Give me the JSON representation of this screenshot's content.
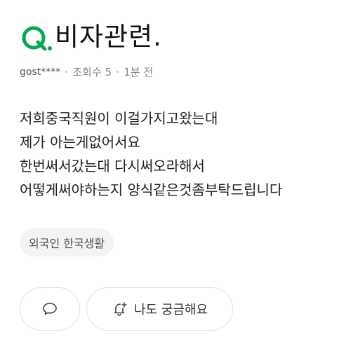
{
  "question": {
    "title": "비자관련."
  },
  "meta": {
    "author": "gost****",
    "views_label": "조회수",
    "views_count": "5",
    "time": "1분 전"
  },
  "body": {
    "lines": [
      "저희중국직원이 이걸가지고왔는대",
      "제가 아는게없어서요",
      "한번써서갔는대 다시써오라해서",
      "어떻게써야하는지 양식같은것좀부탁드립니다"
    ]
  },
  "tag": {
    "label": "외국인 한국생활"
  },
  "actions": {
    "comment_icon": "speech-bubble-icon",
    "curious_icon": "bell-plus-icon",
    "curious_label": "나도 궁금해요"
  },
  "colors": {
    "accent": "#03a94f",
    "tag_bg": "#f3f3f3",
    "border": "#e2e2e2"
  }
}
